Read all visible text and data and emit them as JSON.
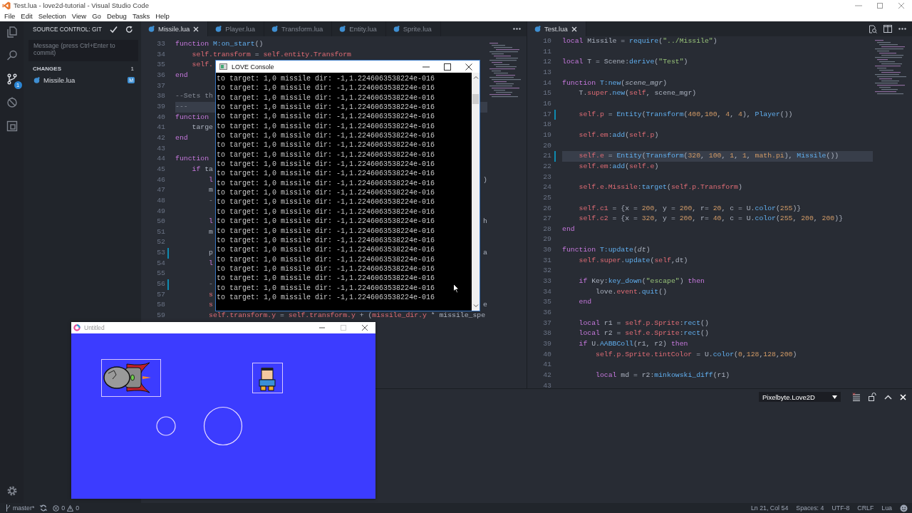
{
  "window": {
    "title": "Test.lua - love2d-tutorial - Visual Studio Code"
  },
  "menu": [
    "File",
    "Edit",
    "Selection",
    "View",
    "Go",
    "Debug",
    "Tasks",
    "Help"
  ],
  "activity_bar": [
    {
      "kind": "files",
      "selected": false
    },
    {
      "kind": "search",
      "selected": false
    },
    {
      "kind": "scm",
      "selected": true,
      "badge": "1"
    },
    {
      "kind": "debug",
      "selected": false
    },
    {
      "kind": "extensions",
      "selected": false
    }
  ],
  "source_control": {
    "title": "SOURCE CONTROL: GIT",
    "message": {
      "placeholder": "Message (press Ctrl+Enter to commit)"
    },
    "changes_label": "CHANGES",
    "changes_count": "1",
    "files": [
      {
        "name": "Missile.lua",
        "status": "M"
      }
    ]
  },
  "editor_left": {
    "tabs": [
      {
        "label": "Missile.lua",
        "selected": true
      },
      {
        "label": "Player.lua",
        "selected": false
      },
      {
        "label": "Transform.lua",
        "selected": false
      },
      {
        "label": "Entity.lua",
        "selected": false
      },
      {
        "label": "Sprite.lua",
        "selected": false
      }
    ],
    "lines": [
      {
        "n": "33",
        "t": [
          {
            "kind": "keyword",
            "text": "function "
          },
          {
            "kind": "function",
            "text": "M:on_start"
          },
          {
            "kind": "plain",
            "text": "()"
          }
        ],
        "modified": false,
        "current": false
      },
      {
        "n": "34",
        "t": [
          {
            "kind": "variable",
            "text": "    self.transform"
          },
          {
            "kind": "plain",
            "text": " = "
          },
          {
            "kind": "variable",
            "text": "self.entity.Transform"
          }
        ],
        "modified": false,
        "current": false
      },
      {
        "n": "35",
        "t": [
          {
            "kind": "variable",
            "text": "    self."
          }
        ],
        "modified": false,
        "current": false
      },
      {
        "n": "36",
        "t": [
          {
            "kind": "keyword",
            "text": "end"
          }
        ],
        "modified": false,
        "current": false
      },
      {
        "n": "37",
        "modified": false,
        "current": false
      },
      {
        "n": "38",
        "t": [
          {
            "kind": "comment",
            "text": "--Sets th"
          }
        ],
        "modified": false,
        "current": false
      },
      {
        "n": "39",
        "t": [
          {
            "kind": "comment",
            "text": "---"
          }
        ],
        "modified": false,
        "current": true
      },
      {
        "n": "40",
        "t": [
          {
            "kind": "keyword",
            "text": "function"
          }
        ],
        "modified": false,
        "current": false
      },
      {
        "n": "41",
        "t": [
          {
            "kind": "plain",
            "text": "    targe"
          }
        ],
        "modified": false,
        "current": false
      },
      {
        "n": "42",
        "t": [
          {
            "kind": "keyword",
            "text": "end"
          }
        ],
        "modified": false,
        "current": false
      },
      {
        "n": "43",
        "modified": false,
        "current": false
      },
      {
        "n": "44",
        "t": [
          {
            "kind": "keyword",
            "text": "function"
          }
        ],
        "modified": false,
        "current": false
      },
      {
        "n": "45",
        "t": [
          {
            "kind": "keyword",
            "text": "    if"
          },
          {
            "kind": "plain",
            "text": " ta"
          }
        ],
        "modified": false,
        "current": false
      },
      {
        "n": "46",
        "t": [
          {
            "kind": "keyword",
            "text": "        l"
          }
        ],
        "tail": ")",
        "modified": false,
        "current": false
      },
      {
        "n": "47",
        "t": [
          {
            "kind": "plain",
            "text": "        m"
          }
        ],
        "modified": false,
        "current": false
      },
      {
        "n": "48",
        "t": [
          {
            "kind": "comment",
            "text": "        -"
          }
        ],
        "modified": false,
        "current": false
      },
      {
        "n": "49",
        "modified": false,
        "current": false
      },
      {
        "n": "50",
        "t": [
          {
            "kind": "keyword",
            "text": "        l"
          }
        ],
        "tail": "h",
        "modified": false,
        "current": false
      },
      {
        "n": "51",
        "t": [
          {
            "kind": "plain",
            "text": "        m"
          }
        ],
        "modified": false,
        "current": false
      },
      {
        "n": "52",
        "modified": false,
        "current": false
      },
      {
        "n": "53",
        "t": [
          {
            "kind": "plain",
            "text": "        p"
          }
        ],
        "tail": "a",
        "modified": true,
        "current": false
      },
      {
        "n": "54",
        "t": [
          {
            "kind": "keyword",
            "text": "        l"
          }
        ],
        "modified": false,
        "current": false
      },
      {
        "n": "55",
        "modified": false,
        "current": false
      },
      {
        "n": "56",
        "t": [
          {
            "kind": "comment",
            "text": "        -"
          }
        ],
        "modified": true,
        "current": false
      },
      {
        "n": "57",
        "t": [
          {
            "kind": "variable",
            "text": "        s"
          }
        ],
        "modified": false,
        "current": false
      },
      {
        "n": "58",
        "t": [
          {
            "kind": "variable",
            "text": "        s"
          }
        ],
        "tail": "e",
        "modified": false,
        "current": false
      },
      {
        "n": "59",
        "t": [
          {
            "kind": "variable",
            "text": "        self.transform.y"
          },
          {
            "kind": "plain",
            "text": " = "
          },
          {
            "kind": "variable",
            "text": "self.transform.y"
          },
          {
            "kind": "plain",
            "text": " + ("
          },
          {
            "kind": "variable",
            "text": "missile_dir.y"
          },
          {
            "kind": "plain",
            "text": " * missile_spe"
          }
        ],
        "modified": false,
        "current": false
      }
    ]
  },
  "editor_right": {
    "tabs": [
      {
        "label": "Test.lua",
        "selected": true
      }
    ],
    "lines": [
      {
        "n": "10",
        "t": [
          {
            "kind": "keyword",
            "text": "local"
          },
          {
            "kind": "plain",
            "text": " Missile = "
          },
          {
            "kind": "function",
            "text": "require"
          },
          {
            "kind": "plain",
            "text": "("
          },
          {
            "kind": "string",
            "text": "\"../Missile\""
          },
          {
            "kind": "plain",
            "text": ")"
          }
        ],
        "modified": false,
        "current": false
      },
      {
        "n": "11",
        "modified": false,
        "current": false
      },
      {
        "n": "12",
        "t": [
          {
            "kind": "keyword",
            "text": "local"
          },
          {
            "kind": "plain",
            "text": " T = Scene:"
          },
          {
            "kind": "function",
            "text": "derive"
          },
          {
            "kind": "plain",
            "text": "("
          },
          {
            "kind": "string",
            "text": "\"Test\""
          },
          {
            "kind": "plain",
            "text": ")"
          }
        ],
        "modified": false,
        "current": false
      },
      {
        "n": "13",
        "modified": false,
        "current": false
      },
      {
        "n": "14",
        "t": [
          {
            "kind": "keyword",
            "text": "function "
          },
          {
            "kind": "function",
            "text": "T:new"
          },
          {
            "kind": "plain",
            "text": "("
          },
          {
            "kind": "param",
            "text": "scene_mgr"
          },
          {
            "kind": "plain",
            "text": ")"
          }
        ],
        "modified": false,
        "current": false
      },
      {
        "n": "15",
        "t": [
          {
            "kind": "plain",
            "text": "    T."
          },
          {
            "kind": "variable",
            "text": "super"
          },
          {
            "kind": "plain",
            "text": "."
          },
          {
            "kind": "function",
            "text": "new"
          },
          {
            "kind": "plain",
            "text": "("
          },
          {
            "kind": "variable",
            "text": "self"
          },
          {
            "kind": "plain",
            "text": ", scene_mgr)"
          }
        ],
        "modified": false,
        "current": false
      },
      {
        "n": "16",
        "modified": false,
        "current": false
      },
      {
        "n": "17",
        "t": [
          {
            "kind": "variable",
            "text": "    self.p"
          },
          {
            "kind": "plain",
            "text": " = "
          },
          {
            "kind": "function",
            "text": "Entity"
          },
          {
            "kind": "plain",
            "text": "("
          },
          {
            "kind": "function",
            "text": "Transform"
          },
          {
            "kind": "plain",
            "text": "("
          },
          {
            "kind": "number",
            "text": "400"
          },
          {
            "kind": "plain",
            "text": ","
          },
          {
            "kind": "number",
            "text": "100"
          },
          {
            "kind": "plain",
            "text": ", "
          },
          {
            "kind": "number",
            "text": "4"
          },
          {
            "kind": "plain",
            "text": ", "
          },
          {
            "kind": "number",
            "text": "4"
          },
          {
            "kind": "plain",
            "text": "), "
          },
          {
            "kind": "function",
            "text": "Player"
          },
          {
            "kind": "plain",
            "text": "())"
          }
        ],
        "modified": true,
        "current": false
      },
      {
        "n": "18",
        "modified": false,
        "current": false
      },
      {
        "n": "19",
        "t": [
          {
            "kind": "variable",
            "text": "    self.em"
          },
          {
            "kind": "plain",
            "text": ":"
          },
          {
            "kind": "function",
            "text": "add"
          },
          {
            "kind": "plain",
            "text": "("
          },
          {
            "kind": "variable",
            "text": "self.p"
          },
          {
            "kind": "plain",
            "text": ")"
          }
        ],
        "modified": false,
        "current": false
      },
      {
        "n": "20",
        "modified": false,
        "current": false
      },
      {
        "n": "21",
        "t": [
          {
            "kind": "variable",
            "text": "    self.e"
          },
          {
            "kind": "plain",
            "text": " = "
          },
          {
            "kind": "function",
            "text": "Entity"
          },
          {
            "kind": "plain",
            "text": "("
          },
          {
            "kind": "function",
            "text": "Transform"
          },
          {
            "kind": "plain",
            "text": "("
          },
          {
            "kind": "number",
            "text": "320"
          },
          {
            "kind": "plain",
            "text": ", "
          },
          {
            "kind": "number",
            "text": "100"
          },
          {
            "kind": "plain",
            "text": ", "
          },
          {
            "kind": "number",
            "text": "1"
          },
          {
            "kind": "plain",
            "text": ", "
          },
          {
            "kind": "number",
            "text": "1"
          },
          {
            "kind": "plain",
            "text": ", "
          },
          {
            "kind": "number",
            "text": "math.pi"
          },
          {
            "kind": "plain",
            "text": "), "
          },
          {
            "kind": "function",
            "text": "Missile"
          },
          {
            "kind": "plain",
            "text": "())"
          }
        ],
        "modified": true,
        "current": true
      },
      {
        "n": "22",
        "t": [
          {
            "kind": "variable",
            "text": "    self.em"
          },
          {
            "kind": "plain",
            "text": ":"
          },
          {
            "kind": "function",
            "text": "add"
          },
          {
            "kind": "plain",
            "text": "("
          },
          {
            "kind": "variable",
            "text": "self.e"
          },
          {
            "kind": "plain",
            "text": ")"
          }
        ],
        "modified": false,
        "current": false
      },
      {
        "n": "23",
        "modified": false,
        "current": false
      },
      {
        "n": "24",
        "t": [
          {
            "kind": "variable",
            "text": "    self.e.Missile"
          },
          {
            "kind": "plain",
            "text": ":"
          },
          {
            "kind": "function",
            "text": "target"
          },
          {
            "kind": "plain",
            "text": "("
          },
          {
            "kind": "variable",
            "text": "self.p.Transform"
          },
          {
            "kind": "plain",
            "text": ")"
          }
        ],
        "modified": false,
        "current": false
      },
      {
        "n": "25",
        "modified": false,
        "current": false
      },
      {
        "n": "26",
        "t": [
          {
            "kind": "variable",
            "text": "    self.c1"
          },
          {
            "kind": "plain",
            "text": " = {x = "
          },
          {
            "kind": "number",
            "text": "200"
          },
          {
            "kind": "plain",
            "text": ", y = "
          },
          {
            "kind": "number",
            "text": "200"
          },
          {
            "kind": "plain",
            "text": ", r= "
          },
          {
            "kind": "number",
            "text": "20"
          },
          {
            "kind": "plain",
            "text": ", c = U."
          },
          {
            "kind": "function",
            "text": "color"
          },
          {
            "kind": "plain",
            "text": "("
          },
          {
            "kind": "number",
            "text": "255"
          },
          {
            "kind": "plain",
            "text": ")}"
          }
        ],
        "modified": false,
        "current": false
      },
      {
        "n": "27",
        "t": [
          {
            "kind": "variable",
            "text": "    self.c2"
          },
          {
            "kind": "plain",
            "text": " = {x = "
          },
          {
            "kind": "number",
            "text": "320"
          },
          {
            "kind": "plain",
            "text": ", y = "
          },
          {
            "kind": "number",
            "text": "200"
          },
          {
            "kind": "plain",
            "text": ", r= "
          },
          {
            "kind": "number",
            "text": "40"
          },
          {
            "kind": "plain",
            "text": ", c = U."
          },
          {
            "kind": "function",
            "text": "color"
          },
          {
            "kind": "plain",
            "text": "("
          },
          {
            "kind": "number",
            "text": "255"
          },
          {
            "kind": "plain",
            "text": ", "
          },
          {
            "kind": "number",
            "text": "200"
          },
          {
            "kind": "plain",
            "text": ", "
          },
          {
            "kind": "number",
            "text": "200"
          },
          {
            "kind": "plain",
            "text": ")}"
          }
        ],
        "modified": false,
        "current": false
      },
      {
        "n": "28",
        "t": [
          {
            "kind": "keyword",
            "text": "end"
          }
        ],
        "modified": false,
        "current": false
      },
      {
        "n": "29",
        "modified": false,
        "current": false
      },
      {
        "n": "30",
        "t": [
          {
            "kind": "keyword",
            "text": "function "
          },
          {
            "kind": "function",
            "text": "T:update"
          },
          {
            "kind": "plain",
            "text": "("
          },
          {
            "kind": "param",
            "text": "dt"
          },
          {
            "kind": "plain",
            "text": ")"
          }
        ],
        "modified": false,
        "current": false
      },
      {
        "n": "31",
        "t": [
          {
            "kind": "variable",
            "text": "    self.super"
          },
          {
            "kind": "plain",
            "text": "."
          },
          {
            "kind": "function",
            "text": "update"
          },
          {
            "kind": "plain",
            "text": "("
          },
          {
            "kind": "variable",
            "text": "self"
          },
          {
            "kind": "plain",
            "text": ",dt)"
          }
        ],
        "modified": false,
        "current": false
      },
      {
        "n": "32",
        "modified": false,
        "current": false
      },
      {
        "n": "33",
        "t": [
          {
            "kind": "keyword",
            "text": "    if"
          },
          {
            "kind": "plain",
            "text": " Key:"
          },
          {
            "kind": "function",
            "text": "key_down"
          },
          {
            "kind": "plain",
            "text": "("
          },
          {
            "kind": "string",
            "text": "\"escape\""
          },
          {
            "kind": "plain",
            "text": ") "
          },
          {
            "kind": "keyword",
            "text": "then"
          }
        ],
        "modified": false,
        "current": false
      },
      {
        "n": "34",
        "t": [
          {
            "kind": "plain",
            "text": "        love."
          },
          {
            "kind": "variable",
            "text": "event"
          },
          {
            "kind": "plain",
            "text": "."
          },
          {
            "kind": "function",
            "text": "quit"
          },
          {
            "kind": "plain",
            "text": "()"
          }
        ],
        "modified": false,
        "current": false
      },
      {
        "n": "35",
        "t": [
          {
            "kind": "keyword",
            "text": "    end"
          }
        ],
        "modified": false,
        "current": false
      },
      {
        "n": "36",
        "modified": false,
        "current": false
      },
      {
        "n": "37",
        "t": [
          {
            "kind": "keyword",
            "text": "    local"
          },
          {
            "kind": "plain",
            "text": " r1 = "
          },
          {
            "kind": "variable",
            "text": "self.p.Sprite"
          },
          {
            "kind": "plain",
            "text": ":"
          },
          {
            "kind": "function",
            "text": "rect"
          },
          {
            "kind": "plain",
            "text": "()"
          }
        ],
        "modified": false,
        "current": false
      },
      {
        "n": "38",
        "t": [
          {
            "kind": "keyword",
            "text": "    local"
          },
          {
            "kind": "plain",
            "text": " r2 = "
          },
          {
            "kind": "variable",
            "text": "self.e.Sprite"
          },
          {
            "kind": "plain",
            "text": ":"
          },
          {
            "kind": "function",
            "text": "rect"
          },
          {
            "kind": "plain",
            "text": "()"
          }
        ],
        "modified": false,
        "current": false
      },
      {
        "n": "39",
        "t": [
          {
            "kind": "keyword",
            "text": "    if"
          },
          {
            "kind": "plain",
            "text": " U."
          },
          {
            "kind": "function",
            "text": "AABBColl"
          },
          {
            "kind": "plain",
            "text": "(r1, r2) "
          },
          {
            "kind": "keyword",
            "text": "then"
          }
        ],
        "modified": false,
        "current": false
      },
      {
        "n": "40",
        "t": [
          {
            "kind": "variable",
            "text": "        self.p.Sprite.tintColor"
          },
          {
            "kind": "plain",
            "text": " = U."
          },
          {
            "kind": "function",
            "text": "color"
          },
          {
            "kind": "plain",
            "text": "("
          },
          {
            "kind": "number",
            "text": "0"
          },
          {
            "kind": "plain",
            "text": ","
          },
          {
            "kind": "number",
            "text": "128"
          },
          {
            "kind": "plain",
            "text": ","
          },
          {
            "kind": "number",
            "text": "128"
          },
          {
            "kind": "plain",
            "text": ","
          },
          {
            "kind": "number",
            "text": "200"
          },
          {
            "kind": "plain",
            "text": ")"
          }
        ],
        "modified": false,
        "current": false
      },
      {
        "n": "41",
        "modified": false,
        "current": false
      },
      {
        "n": "42",
        "t": [
          {
            "kind": "keyword",
            "text": "        local"
          },
          {
            "kind": "plain",
            "text": " md = r2:"
          },
          {
            "kind": "function",
            "text": "minkowski_diff"
          },
          {
            "kind": "plain",
            "text": "(r1)"
          }
        ],
        "modified": false,
        "current": false
      },
      {
        "n": "43",
        "modified": false,
        "current": false
      }
    ]
  },
  "panel": {
    "dropdown": "Pixelbyte.Love2D"
  },
  "console": {
    "title": "LOVE Console",
    "lines": [
      "to target: 1,0 missile dir: -1,1.2246063538224e-016",
      "to target: 1,0 missile dir: -1,1.2246063538224e-016",
      "to target: 1,0 missile dir: -1,1.2246063538224e-016",
      "to target: 1,0 missile dir: -1,1.2246063538224e-016",
      "to target: 1,0 missile dir: -1,1.2246063538224e-016",
      "to target: 1,0 missile dir: -1,1.2246063538224e-016",
      "to target: 1,0 missile dir: -1,1.2246063538224e-016",
      "to target: 1,0 missile dir: -1,1.2246063538224e-016",
      "to target: 1,0 missile dir: -1,1.2246063538224e-016",
      "to target: 1,0 missile dir: -1,1.2246063538224e-016",
      "to target: 1,0 missile dir: -1,1.2246063538224e-016",
      "to target: 1,0 missile dir: -1,1.2246063538224e-016",
      "to target: 1,0 missile dir: -1,1.2246063538224e-016",
      "to target: 1,0 missile dir: -1,1.2246063538224e-016",
      "to target: 1,0 missile dir: -1,1.2246063538224e-016",
      "to target: 1,0 missile dir: -1,1.2246063538224e-016",
      "to target: 1,0 missile dir: -1,1.2246063538224e-016",
      "to target: 1,0 missile dir: -1,1.2246063538224e-016",
      "to target: 1,0 missile dir: -1,1.2246063538224e-016",
      "to target: 1,0 missile dir: -1,1.2246063538224e-016",
      "to target: 1,0 missile dir: -1,1.2246063538224e-016",
      "to target: 1,0 missile dir: -1,1.2246063538224e-016",
      "to target: 1,0 missile dir: -1,1.2246063538224e-016",
      "to target: 1,0 missile dir: -1,1.2246063538224e-016"
    ]
  },
  "game": {
    "title": "Untitled"
  },
  "status_bar": {
    "branch": "master*",
    "errors": "0",
    "warnings": "0",
    "items": [
      "Ln 21, Col 54",
      "Spaces: 4",
      "UTF-8",
      "CRLF",
      "Lua"
    ]
  }
}
